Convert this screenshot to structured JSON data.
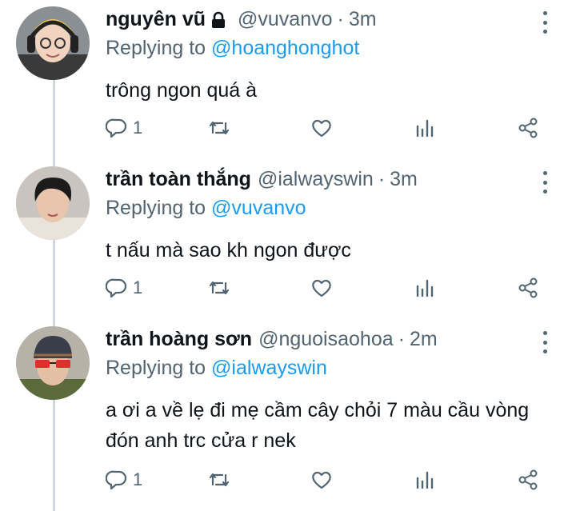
{
  "tweets": [
    {
      "name": "nguyên vũ",
      "handle": "@vuvanvo",
      "sep": "·",
      "time": "3m",
      "locked": true,
      "reply_prefix": "Replying to",
      "reply_to": "@hoanghonghot",
      "text": "trông ngon quá à",
      "reply_count": "1"
    },
    {
      "name": "trần toàn thắng",
      "handle": "@ialwayswin",
      "sep": "·",
      "time": "3m",
      "locked": false,
      "reply_prefix": "Replying to",
      "reply_to": "@vuvanvo",
      "text": "t nấu mà sao kh ngon được",
      "reply_count": "1"
    },
    {
      "name": "trần hoàng sơn",
      "handle": "@nguoisaohoa",
      "sep": "·",
      "time": "2m",
      "locked": false,
      "reply_prefix": "Replying to",
      "reply_to": "@ialwayswin",
      "text": "a ơi a về lẹ đi mẹ cầm cây chỏi 7 màu cầu vòng đón anh trc cửa r nek",
      "reply_count": "1"
    }
  ],
  "icons": {
    "reply": "reply-icon",
    "retweet": "retweet-icon",
    "like": "heart-icon",
    "views": "analytics-icon",
    "share": "share-icon",
    "more": "more-icon",
    "lock": "lock-icon"
  },
  "colors": {
    "accent": "#1d9bf0",
    "muted": "#536471",
    "text": "#0f1419",
    "thread": "#cfd9de"
  }
}
